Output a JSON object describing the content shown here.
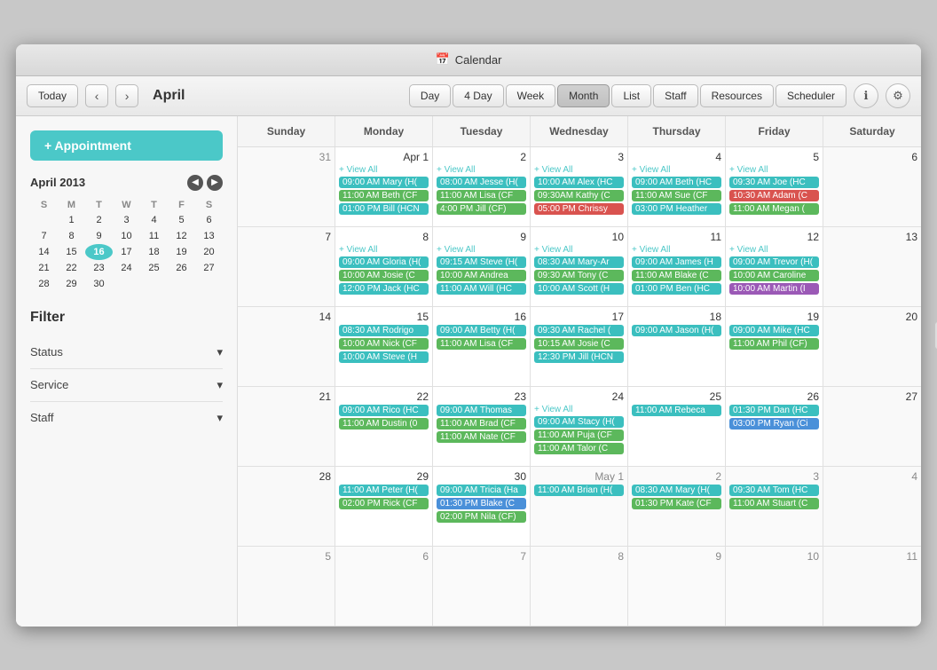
{
  "window": {
    "title": "Calendar",
    "icon": "📅"
  },
  "toolbar": {
    "today_label": "Today",
    "prev_label": "‹",
    "next_label": "›",
    "month_label": "April",
    "view_buttons": [
      "Day",
      "4 Day",
      "Week",
      "Month",
      "List",
      "Staff",
      "Resources",
      "Scheduler"
    ]
  },
  "sidebar": {
    "add_button_label": "+ Appointment",
    "mini_cal_title": "April 2013",
    "mini_cal_days_header": [
      "S",
      "M",
      "T",
      "W",
      "T",
      "F",
      "S"
    ],
    "mini_cal_weeks": [
      [
        "",
        "1",
        "2",
        "3",
        "4",
        "5",
        "6"
      ],
      [
        "7",
        "8",
        "9",
        "10",
        "11",
        "12",
        "13"
      ],
      [
        "14",
        "15",
        "16",
        "17",
        "18",
        "19",
        "20"
      ],
      [
        "21",
        "22",
        "23",
        "24",
        "25",
        "26",
        "27"
      ],
      [
        "28",
        "29",
        "30",
        "",
        "",
        "",
        ""
      ]
    ],
    "today_date": "16",
    "filter_title": "Filter",
    "filter_items": [
      "Status",
      "Service",
      "Staff"
    ]
  },
  "calendar": {
    "day_names": [
      "Sunday",
      "Monday",
      "Tuesday",
      "Wednesday",
      "Thursday",
      "Friday",
      "Saturday"
    ],
    "weeks": [
      {
        "days": [
          {
            "number": "31",
            "type": "other",
            "events": []
          },
          {
            "number": "Apr 1",
            "type": "current",
            "view_all": true,
            "events": [
              {
                "label": "09:00 AM Mary (H(",
                "color": "ev-teal"
              },
              {
                "label": "11:00 AM Beth (CF",
                "color": "ev-green"
              },
              {
                "label": "01:00 PM Bill (HCN",
                "color": "ev-teal"
              }
            ]
          },
          {
            "number": "2",
            "type": "current",
            "view_all": true,
            "events": [
              {
                "label": "08:00 AM Jesse (H(",
                "color": "ev-teal"
              },
              {
                "label": "11:00 AM Lisa (CF",
                "color": "ev-green"
              },
              {
                "label": "4:00 PM Jill (CF)",
                "color": "ev-green"
              }
            ]
          },
          {
            "number": "3",
            "type": "current",
            "view_all": true,
            "events": [
              {
                "label": "10:00 AM Alex (HC",
                "color": "ev-teal"
              },
              {
                "label": "09:30AM Kathy (C",
                "color": "ev-green"
              },
              {
                "label": "05:00 PM Chrissy",
                "color": "ev-red"
              }
            ]
          },
          {
            "number": "4",
            "type": "current",
            "view_all": true,
            "events": [
              {
                "label": "09:00 AM Beth (HC",
                "color": "ev-teal"
              },
              {
                "label": "11:00 AM Sue (CF",
                "color": "ev-green"
              },
              {
                "label": "03:00 PM Heather",
                "color": "ev-teal"
              }
            ]
          },
          {
            "number": "5",
            "type": "current",
            "view_all": true,
            "events": [
              {
                "label": "09:30 AM Joe (HC",
                "color": "ev-teal"
              },
              {
                "label": "10:30 AM Adam (C",
                "color": "ev-red"
              },
              {
                "label": "11:00 AM Megan (",
                "color": "ev-green"
              }
            ]
          },
          {
            "number": "6",
            "type": "current",
            "events": []
          }
        ]
      },
      {
        "days": [
          {
            "number": "7",
            "type": "current",
            "events": []
          },
          {
            "number": "8",
            "type": "current",
            "view_all": true,
            "events": [
              {
                "label": "09:00 AM Gloria (H(",
                "color": "ev-teal"
              },
              {
                "label": "10:00 AM Josie (C",
                "color": "ev-green"
              },
              {
                "label": "12:00 PM Jack (HC",
                "color": "ev-teal"
              }
            ]
          },
          {
            "number": "9",
            "type": "current",
            "view_all": true,
            "events": [
              {
                "label": "09:15 AM Steve (H(",
                "color": "ev-teal"
              },
              {
                "label": "10:00 AM Andrea",
                "color": "ev-green"
              },
              {
                "label": "11:00 AM Will (HC",
                "color": "ev-teal"
              }
            ]
          },
          {
            "number": "10",
            "type": "current",
            "view_all": true,
            "events": [
              {
                "label": "08:30 AM Mary-Ar",
                "color": "ev-teal"
              },
              {
                "label": "09:30 AM Tony (C",
                "color": "ev-green"
              },
              {
                "label": "10:00 AM Scott (H",
                "color": "ev-teal"
              }
            ]
          },
          {
            "number": "11",
            "type": "current",
            "view_all": true,
            "events": [
              {
                "label": "09:00 AM James (H",
                "color": "ev-teal"
              },
              {
                "label": "11:00 AM Blake (C",
                "color": "ev-green"
              },
              {
                "label": "01:00 PM Ben (HC",
                "color": "ev-teal"
              }
            ]
          },
          {
            "number": "12",
            "type": "current",
            "view_all": true,
            "events": [
              {
                "label": "09:00 AM Trevor (H(",
                "color": "ev-teal"
              },
              {
                "label": "10:00 AM Caroline",
                "color": "ev-green"
              },
              {
                "label": "10:00 AM Martin (I",
                "color": "ev-purple"
              }
            ]
          },
          {
            "number": "13",
            "type": "current",
            "events": []
          }
        ]
      },
      {
        "days": [
          {
            "number": "14",
            "type": "current",
            "events": []
          },
          {
            "number": "15",
            "type": "current",
            "view_all": false,
            "events": [
              {
                "label": "08:30 AM Rodrigo",
                "color": "ev-teal"
              },
              {
                "label": "10:00 AM Nick (CF",
                "color": "ev-green"
              },
              {
                "label": "10:00 AM Steve (H",
                "color": "ev-teal"
              }
            ]
          },
          {
            "number": "16",
            "type": "current",
            "view_all": false,
            "events": [
              {
                "label": "09:00 AM Betty (H(",
                "color": "ev-teal"
              },
              {
                "label": "11:00 AM Lisa (CF",
                "color": "ev-green"
              },
              {
                "label": "",
                "color": ""
              }
            ]
          },
          {
            "number": "17",
            "type": "current",
            "view_all": false,
            "events": [
              {
                "label": "09:30 AM Rachel (",
                "color": "ev-teal"
              },
              {
                "label": "10:15 AM Josie (C",
                "color": "ev-green"
              },
              {
                "label": "12:30 PM Jill (HCN",
                "color": "ev-teal"
              }
            ]
          },
          {
            "number": "18",
            "type": "current",
            "view_all": false,
            "events": [
              {
                "label": "09:00 AM Jason (H(",
                "color": "ev-teal"
              }
            ]
          },
          {
            "number": "19",
            "type": "current",
            "view_all": false,
            "events": [
              {
                "label": "09:00 AM Mike (HC",
                "color": "ev-teal"
              },
              {
                "label": "11:00 AM Phil (CF)",
                "color": "ev-green"
              }
            ]
          },
          {
            "number": "20",
            "type": "current",
            "events": []
          }
        ]
      },
      {
        "days": [
          {
            "number": "21",
            "type": "current",
            "events": []
          },
          {
            "number": "22",
            "type": "current",
            "view_all": false,
            "events": [
              {
                "label": "09:00 AM Rico (HC",
                "color": "ev-teal"
              },
              {
                "label": "11:00 AM Dustin (0",
                "color": "ev-green"
              }
            ]
          },
          {
            "number": "23",
            "type": "current",
            "view_all": false,
            "events": [
              {
                "label": "09:00 AM Thomas",
                "color": "ev-teal"
              },
              {
                "label": "11:00 AM Brad (CF",
                "color": "ev-green"
              },
              {
                "label": "11:00 AM Nate (CF",
                "color": "ev-green"
              }
            ]
          },
          {
            "number": "24",
            "type": "current",
            "view_all": true,
            "events": [
              {
                "label": "09:00 AM Stacy (H(",
                "color": "ev-teal"
              },
              {
                "label": "11:00 AM Puja (CF",
                "color": "ev-green"
              },
              {
                "label": "11:00 AM Talor (C",
                "color": "ev-green"
              }
            ]
          },
          {
            "number": "25",
            "type": "current",
            "view_all": false,
            "events": [
              {
                "label": "11:00 AM Rebeca",
                "color": "ev-teal"
              }
            ]
          },
          {
            "number": "26",
            "type": "current",
            "view_all": false,
            "events": [
              {
                "label": "01:30 PM Dan (HC",
                "color": "ev-teal"
              },
              {
                "label": "03:00 PM Ryan (Ci",
                "color": "ev-blue"
              }
            ]
          },
          {
            "number": "27",
            "type": "current",
            "events": []
          }
        ]
      },
      {
        "days": [
          {
            "number": "28",
            "type": "current",
            "events": []
          },
          {
            "number": "29",
            "type": "current",
            "view_all": false,
            "events": [
              {
                "label": "11:00 AM Peter (H(",
                "color": "ev-teal"
              },
              {
                "label": "02:00 PM Rick (CF",
                "color": "ev-green"
              }
            ]
          },
          {
            "number": "30",
            "type": "current",
            "view_all": false,
            "events": [
              {
                "label": "09:00 AM Tricia (Ha",
                "color": "ev-teal"
              },
              {
                "label": "01:30 PM Blake (C",
                "color": "ev-blue"
              },
              {
                "label": "02:00 PM Nila (CF)",
                "color": "ev-green"
              }
            ]
          },
          {
            "number": "May 1",
            "type": "other",
            "view_all": false,
            "events": [
              {
                "label": "11:00 AM Brian (H(",
                "color": "ev-teal"
              }
            ]
          },
          {
            "number": "2",
            "type": "other",
            "view_all": false,
            "events": [
              {
                "label": "08:30 AM Mary (H(",
                "color": "ev-teal"
              },
              {
                "label": "01:30 PM Kate (CF",
                "color": "ev-green"
              }
            ]
          },
          {
            "number": "3",
            "type": "other",
            "view_all": false,
            "events": [
              {
                "label": "09:30 AM Tom (HC",
                "color": "ev-teal"
              },
              {
                "label": "11:00 AM Stuart (C",
                "color": "ev-green"
              }
            ]
          },
          {
            "number": "4",
            "type": "other",
            "events": []
          }
        ]
      },
      {
        "days": [
          {
            "number": "5",
            "type": "other",
            "events": []
          },
          {
            "number": "6",
            "type": "other",
            "events": []
          },
          {
            "number": "7",
            "type": "other",
            "events": []
          },
          {
            "number": "8",
            "type": "other",
            "events": []
          },
          {
            "number": "9",
            "type": "other",
            "events": []
          },
          {
            "number": "10",
            "type": "other",
            "events": []
          },
          {
            "number": "11",
            "type": "other",
            "events": []
          }
        ]
      }
    ]
  }
}
